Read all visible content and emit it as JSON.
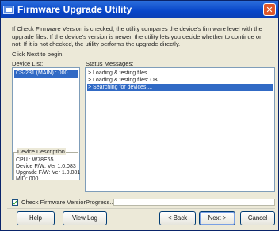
{
  "window": {
    "title": "Firmware Upgrade Utility",
    "close_glyph": "✕"
  },
  "intro": {
    "text": "If Check Firmware Version is checked, the utility compares the device's firmware level with the upgrade files. If the device's version is newer, the utility lets you decide whether to continue or not. If it is not checked, the utility performs the upgrade directly.",
    "click_next": "Click Next to begin."
  },
  "device_list": {
    "label": "Device List:",
    "items": [
      "CS-231 (MAIN) : 000"
    ]
  },
  "device_description": {
    "legend": "Device Description",
    "lines": [
      "CPU : W78E65",
      "Device F/W: Ver 1.0.083",
      "Upgrade F/W: Ver 1.0.081",
      "MID: 000"
    ]
  },
  "status": {
    "label": "Status Messages:",
    "messages": [
      "> Loading & testing files ...",
      "> Loading & testing files: OK",
      "> Searching for devices ..."
    ],
    "selected_index": 2
  },
  "check_firmware": {
    "label": "Check Firmware Version",
    "checked": true
  },
  "progress": {
    "label": "Progress...",
    "value": 0
  },
  "buttons": {
    "help": "Help",
    "view_log": "View Log",
    "back": "< Back",
    "next": "Next >",
    "cancel": "Cancel"
  },
  "colors": {
    "titlebar": "#0846c9",
    "selection": "#316ac5",
    "window_bg": "#ece9d8"
  }
}
